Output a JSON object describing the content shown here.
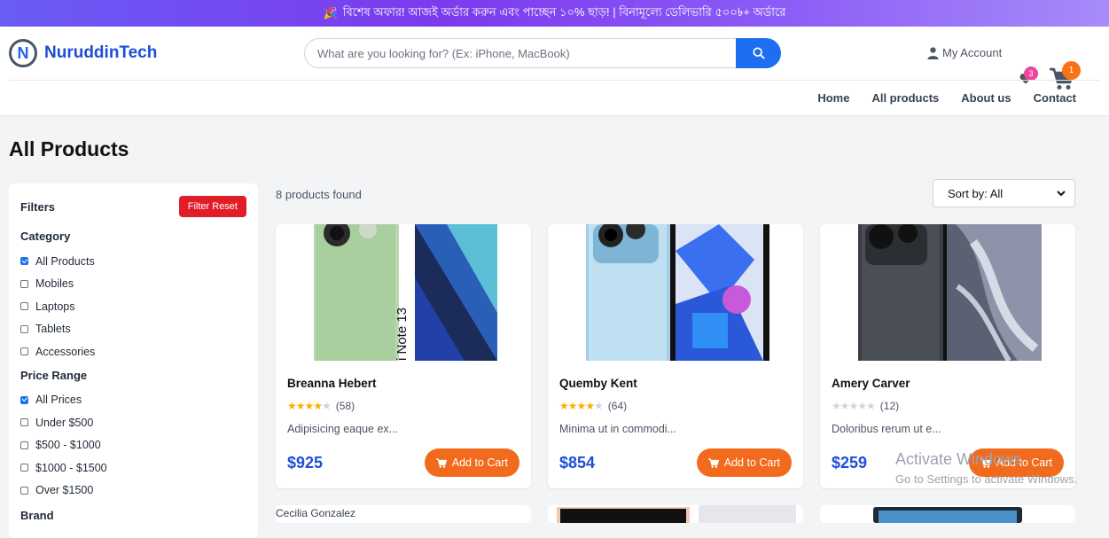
{
  "promo": {
    "icon": "party-popper-icon",
    "text": "বিশেষ অফার! আজই অর্ডার করুন এবং পাচ্ছেন ১০% ছাড়! | বিনামূল্যে ডেলিভারি ৫০০৳+ অর্ডারে"
  },
  "brand": {
    "logo_letter": "N",
    "name": "NuruddinTech",
    "color": "#1d4ed8"
  },
  "search": {
    "placeholder": "What are you looking for? (Ex: iPhone, MacBook)",
    "value": ""
  },
  "account": {
    "label": "My Account"
  },
  "wishlist": {
    "count": "3"
  },
  "cart": {
    "count": "1"
  },
  "nav": [
    "Home",
    "All products",
    "About us",
    "Contact"
  ],
  "page": {
    "title": "All Products",
    "found": "8 products found",
    "sort": "Sort by: All"
  },
  "filters": {
    "title": "Filters",
    "reset": "Filter Reset",
    "category": {
      "label": "Category",
      "options": [
        {
          "label": "All Products",
          "checked": true
        },
        {
          "label": "Mobiles",
          "checked": false
        },
        {
          "label": "Laptops",
          "checked": false
        },
        {
          "label": "Tablets",
          "checked": false
        },
        {
          "label": "Accessories",
          "checked": false
        }
      ]
    },
    "price": {
      "label": "Price Range",
      "options": [
        {
          "label": "All Prices",
          "checked": true
        },
        {
          "label": "Under $500",
          "checked": false
        },
        {
          "label": "$500 - $1000",
          "checked": false
        },
        {
          "label": "$1000 - $1500",
          "checked": false
        },
        {
          "label": "Over $1500",
          "checked": false
        }
      ]
    },
    "brand": {
      "label": "Brand"
    }
  },
  "products": [
    {
      "name": "Breanna Hebert",
      "rating": 4,
      "reviews": "(58)",
      "desc": "Adipisicing eaque ex...",
      "price": "$925",
      "cta": "Add to Cart",
      "image_text": "i Note 13"
    },
    {
      "name": "Quemby Kent",
      "rating": 4,
      "reviews": "(64)",
      "desc": "Minima ut in commodi...",
      "price": "$854",
      "cta": "Add to Cart"
    },
    {
      "name": "Amery Carver",
      "rating": 0,
      "reviews": "(12)",
      "desc": "Doloribus rerum ut e...",
      "price": "$259",
      "cta": "Add to Cart"
    }
  ],
  "next_row": {
    "first_alt": "Cecilia Gonzalez"
  },
  "watermark": {
    "line1": "Activate Windows",
    "line2": "Go to Settings to activate Windows."
  }
}
